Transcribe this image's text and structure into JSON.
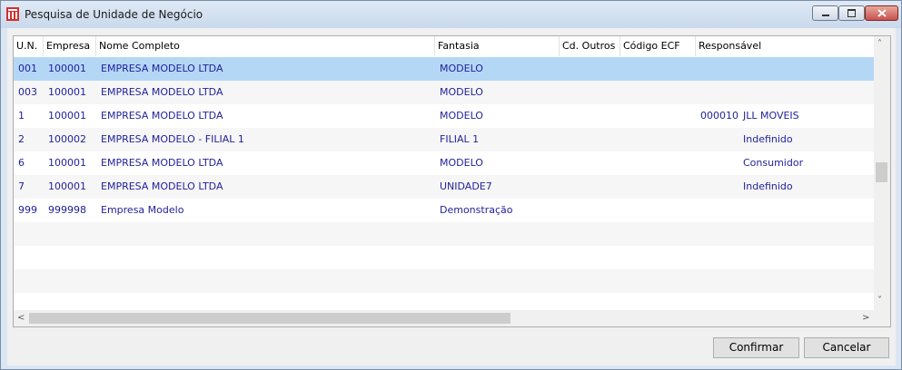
{
  "window": {
    "title": "Pesquisa de Unidade de Negócio"
  },
  "grid": {
    "columns": [
      "U.N.",
      "Empresa",
      "Nome Completo",
      "Fantasia",
      "Cd. Outros",
      "Código ECF",
      "Responsável"
    ],
    "rows": [
      [
        "001",
        "100001",
        "EMPRESA MODELO LTDA",
        "MODELO",
        "",
        "",
        "",
        ""
      ],
      [
        "003",
        "100001",
        "EMPRESA MODELO LTDA",
        "MODELO",
        "",
        "",
        "",
        ""
      ],
      [
        "1",
        "100001",
        "EMPRESA MODELO LTDA",
        "MODELO",
        "",
        "",
        "000010",
        "JLL MOVEIS"
      ],
      [
        "2",
        "100002",
        "EMPRESA MODELO - FILIAL 1",
        "FILIAL 1",
        "",
        "",
        "",
        "Indefinido"
      ],
      [
        "6",
        "100001",
        "EMPRESA MODELO LTDA",
        "MODELO",
        "",
        "",
        "",
        "Consumidor"
      ],
      [
        "7",
        "100001",
        "EMPRESA MODELO LTDA",
        "UNIDADE7",
        "",
        "",
        "",
        "Indefinido"
      ],
      [
        "999",
        "999998",
        "Empresa Modelo",
        "Demonstração",
        "",
        "",
        "",
        ""
      ]
    ],
    "selected_row": 0
  },
  "buttons": {
    "confirm": "Confirmar",
    "cancel": "Cancelar"
  },
  "colors": {
    "selection": "#b5d7f6",
    "row_text": "#1f1f9a",
    "close_button": "#c75050"
  }
}
